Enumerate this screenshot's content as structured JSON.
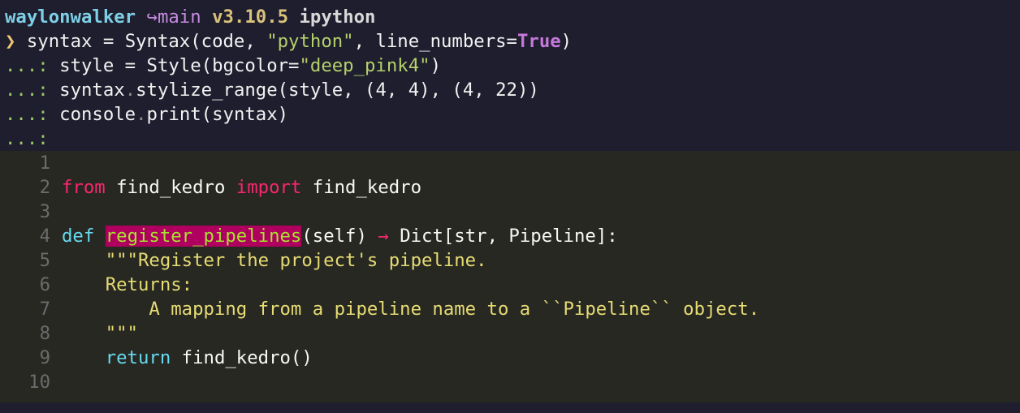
{
  "prompt": {
    "user": "waylonwalker",
    "branch": "↪main",
    "version": "v3.10.5",
    "env": "ipython",
    "arrow": "❯",
    "continuation": "...:"
  },
  "input_lines": [
    {
      "a": "syntax = Syntax(code, ",
      "s": "\"python\"",
      "b": ", line_numbers=",
      "k": "True",
      "c": ")"
    },
    {
      "a": "style = Style(bgcolor=",
      "s": "\"deep_pink4\"",
      "c": ")"
    },
    {
      "a": "syntax",
      "d": ".",
      "b": "stylize_range(style, (4, 4), (4, 22))"
    },
    {
      "a": "console",
      "d": ".",
      "b": "print(syntax)"
    }
  ],
  "code": {
    "line_numbers": [
      "1",
      "2",
      "3",
      "4",
      "5",
      "6",
      "7",
      "8",
      "9",
      "10"
    ],
    "l2": {
      "from": "from",
      "mod": " find_kedro ",
      "import": "import",
      "name": " find_kedro"
    },
    "l4": {
      "def": "def",
      "fn": "register_pipelines",
      "args": "(self) ",
      "arrow": "→",
      "ret": " Dict[str, Pipeline]:"
    },
    "l5": "    \"\"\"Register the project's pipeline.",
    "l6": "    Returns:",
    "l7": "        A mapping from a pipeline name to a ``Pipeline`` object.",
    "l8": "    \"\"\"",
    "l9": {
      "indent": "    ",
      "return": "return",
      "call": " find_kedro()"
    }
  },
  "colors": {
    "background": "#1f1e2e",
    "code_background": "#272822",
    "highlight_bg": "#af005f"
  }
}
